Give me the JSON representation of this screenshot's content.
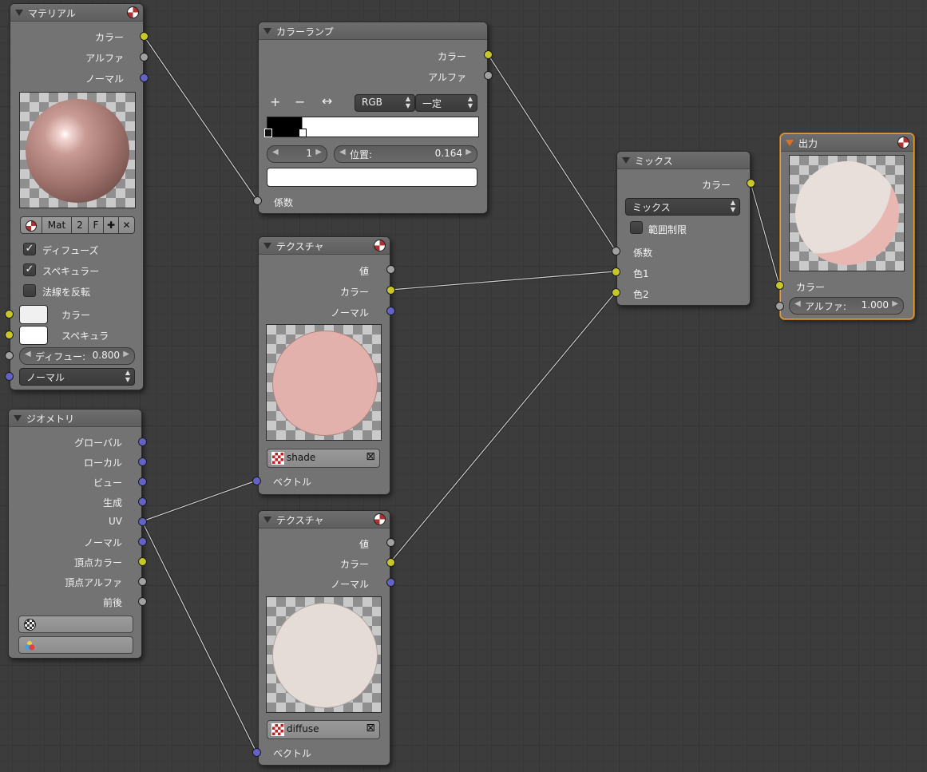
{
  "nodes": {
    "material": {
      "title": "マテリアル",
      "outputs": [
        "カラー",
        "アルファ",
        "ノーマル"
      ],
      "mat_name": "Mat",
      "mat_users": "2",
      "mat_fake": "F",
      "diffuse_label": "ディフューズ",
      "specular_label": "スペキュラー",
      "invert_normal_label": "法線を反転",
      "color_label": "カラー",
      "spec_label": "スペキュラ",
      "diffuse_intensity_label": "ディフュー:",
      "diffuse_intensity_value": "0.800",
      "normal_select": "ノーマル"
    },
    "geometry": {
      "title": "ジオメトリ",
      "outputs": [
        "グローバル",
        "ローカル",
        "ビュー",
        "生成",
        "UV",
        "ノーマル",
        "頂点カラー",
        "頂点アルファ",
        "前後"
      ]
    },
    "colorramp": {
      "title": "カラーランプ",
      "outputs": [
        "カラー",
        "アルファ"
      ],
      "add": "+",
      "remove": "−",
      "flip": "↔",
      "color_mode": "RGB",
      "interpolation": "一定",
      "active_index": "1",
      "position_label": "位置:",
      "position_value": "0.164",
      "input": "係数"
    },
    "texture1": {
      "title": "テクスチャ",
      "outputs": [
        "値",
        "カラー",
        "ノーマル"
      ],
      "texture_name": "shade",
      "input": "ベクトル"
    },
    "texture2": {
      "title": "テクスチャ",
      "outputs": [
        "値",
        "カラー",
        "ノーマル"
      ],
      "texture_name": "diffuse",
      "input": "ベクトル"
    },
    "mix": {
      "title": "ミックス",
      "output": "カラー",
      "blend_type": "ミックス",
      "clamp_label": "範囲制限",
      "inputs": [
        "係数",
        "色1",
        "色2"
      ]
    },
    "output": {
      "title": "出力",
      "input_color": "カラー",
      "alpha_label": "アルファ:",
      "alpha_value": "1.000"
    }
  },
  "colors": {
    "socket_color": "#c7c729",
    "socket_value": "#a1a1a1",
    "socket_vector": "#6363c7",
    "active_node_border": "#f0a030",
    "shade_preview": "#e3b1ac",
    "diffuse_preview": "#e5dcd7"
  }
}
